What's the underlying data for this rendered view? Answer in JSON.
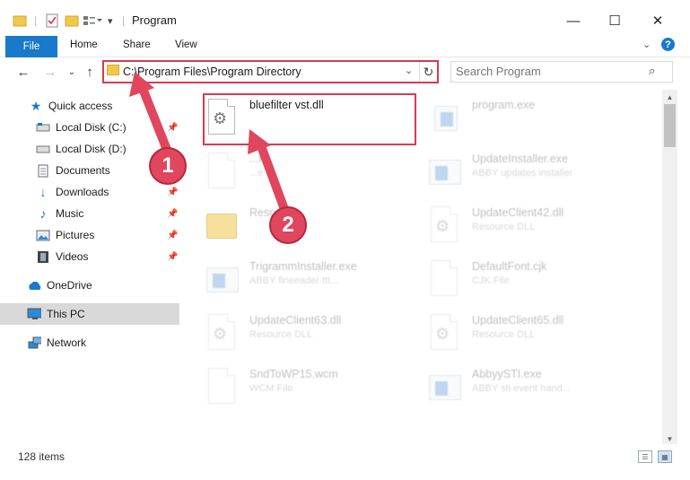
{
  "window": {
    "title": "Program",
    "minimize": "—",
    "maximize": "☐",
    "close": "✕"
  },
  "ribbon": {
    "file": "File",
    "home": "Home",
    "share": "Share",
    "view": "View"
  },
  "address": {
    "path": "C:\\Program Files\\Program Directory"
  },
  "search": {
    "placeholder": "Search Program"
  },
  "sidebar": {
    "items": [
      {
        "label": "Quick access"
      },
      {
        "label": "Local Disk (C:)"
      },
      {
        "label": "Local Disk (D:)"
      },
      {
        "label": "Documents"
      },
      {
        "label": "Downloads"
      },
      {
        "label": "Music"
      },
      {
        "label": "Pictures"
      },
      {
        "label": "Videos"
      },
      {
        "label": "OneDrive"
      },
      {
        "label": "This PC"
      },
      {
        "label": "Network"
      }
    ]
  },
  "files": {
    "left": [
      {
        "name": "bluefilter vst.dll",
        "sub": ""
      },
      {
        "name": "...k",
        "sub": "...e"
      },
      {
        "name": "Reso...",
        "sub": ""
      },
      {
        "name": "TrigrammInstaller.exe",
        "sub": "ABBY fineeader ttt..."
      },
      {
        "name": "UpdateClient63.dll",
        "sub": "Resource DLL"
      },
      {
        "name": "SndToWP15.wcm",
        "sub": "WCM File"
      }
    ],
    "right": [
      {
        "name": "program.exe",
        "sub": ""
      },
      {
        "name": "UpdateInstaller.exe",
        "sub": "ABBY updates installer"
      },
      {
        "name": "UpdateClient42.dll",
        "sub": "Resource DLL"
      },
      {
        "name": "DefaultFont.cjk",
        "sub": "CJK File"
      },
      {
        "name": "UpdateClient65.dll",
        "sub": "Resource DLL"
      },
      {
        "name": "AbbyySTI.exe",
        "sub": "ABBY sti event hand..."
      }
    ]
  },
  "status": {
    "count": "128 items"
  },
  "annotations": {
    "one": "1",
    "two": "2"
  },
  "colors": {
    "accent": "#1979ca",
    "highlight": "#d63b52",
    "badge": "#e0465d"
  }
}
